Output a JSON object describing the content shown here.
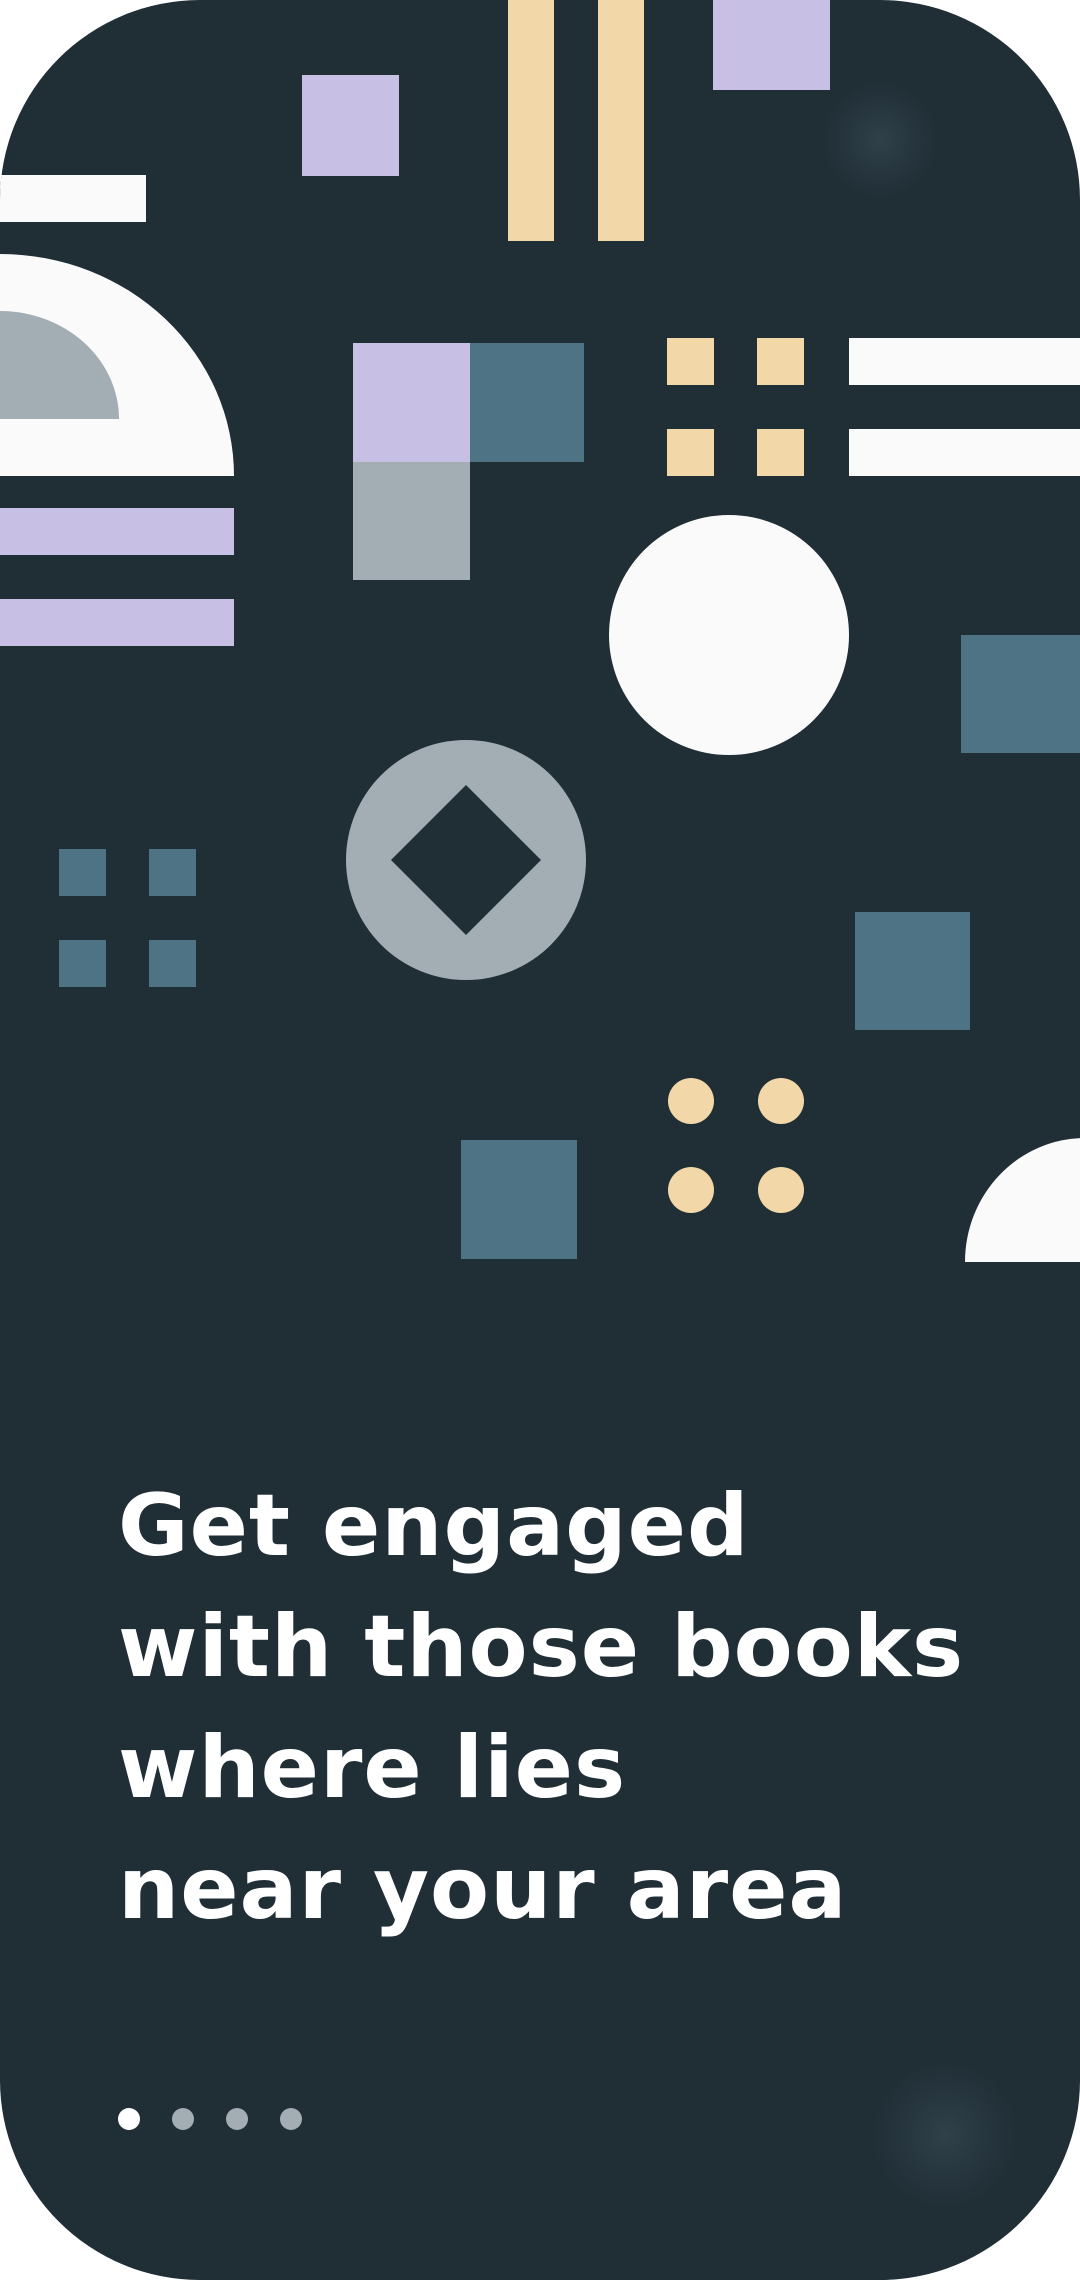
{
  "onboarding": {
    "headline_lines": [
      "Get engaged",
      "with those books",
      "where lies",
      "near your area"
    ],
    "page_indicator": {
      "total_pages": 4,
      "active_page": 1
    }
  },
  "colors": {
    "background": "#202e36",
    "lavender": "#c8bfe4",
    "sand": "#f2d7a9",
    "teal": "#4d7385",
    "slate": "#a3adb4",
    "white": "#fafafa"
  }
}
